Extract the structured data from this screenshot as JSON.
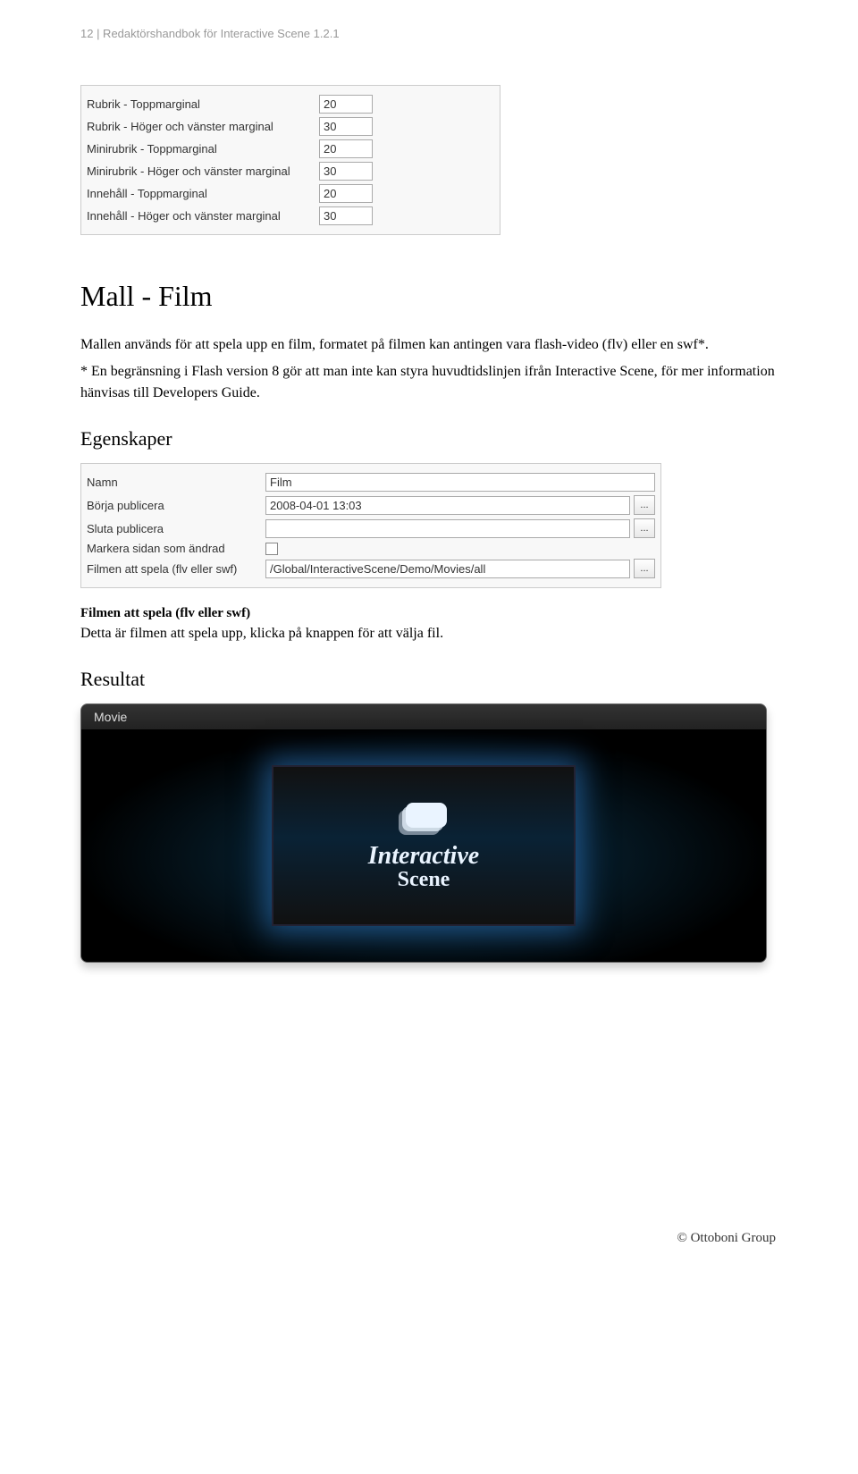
{
  "header": "12  |  Redaktörshandbok för Interactive Scene 1.2.1",
  "marginTable": {
    "rows": [
      {
        "label": "Rubrik - Toppmarginal",
        "value": "20"
      },
      {
        "label": "Rubrik - Höger och vänster marginal",
        "value": "30"
      },
      {
        "label": "Minirubrik - Toppmarginal",
        "value": "20"
      },
      {
        "label": "Minirubrik - Höger och vänster marginal",
        "value": "30"
      },
      {
        "label": "Innehåll - Toppmarginal",
        "value": "20"
      },
      {
        "label": "Innehåll - Höger och vänster marginal",
        "value": "30"
      }
    ]
  },
  "sectionTitle": "Mall - Film",
  "para1": "Mallen används för att spela upp en film, formatet på filmen kan antingen vara flash-video (flv) eller en swf*.",
  "para2": "* En begränsning i Flash version 8 gör att man inte kan styra huvudtidslinjen ifrån Interactive Scene, för mer information hänvisas till Developers Guide.",
  "egenskaperTitle": "Egenskaper",
  "propsTable": {
    "rows": [
      {
        "label": "Namn",
        "value": "Film",
        "type": "text"
      },
      {
        "label": "Börja publicera",
        "value": "2008-04-01 13:03",
        "type": "text-btn"
      },
      {
        "label": "Sluta publicera",
        "value": "",
        "type": "text-btn"
      },
      {
        "label": "Markera sidan som ändrad",
        "value": "",
        "type": "checkbox"
      },
      {
        "label": "Filmen att spela (flv eller swf)",
        "value": "/Global/InteractiveScene/Demo/Movies/all",
        "type": "text-btn"
      }
    ]
  },
  "filmLead": "Filmen att spela (flv eller swf)",
  "filmLeadBody": "Detta är filmen att spela upp, klicka på knappen för att välja fil.",
  "resultTitle": "Resultat",
  "resultTab": "Movie",
  "logoTop": "Interactive",
  "logoSub": "Scene",
  "footer": "© Ottoboni Group",
  "ellipsis": "..."
}
